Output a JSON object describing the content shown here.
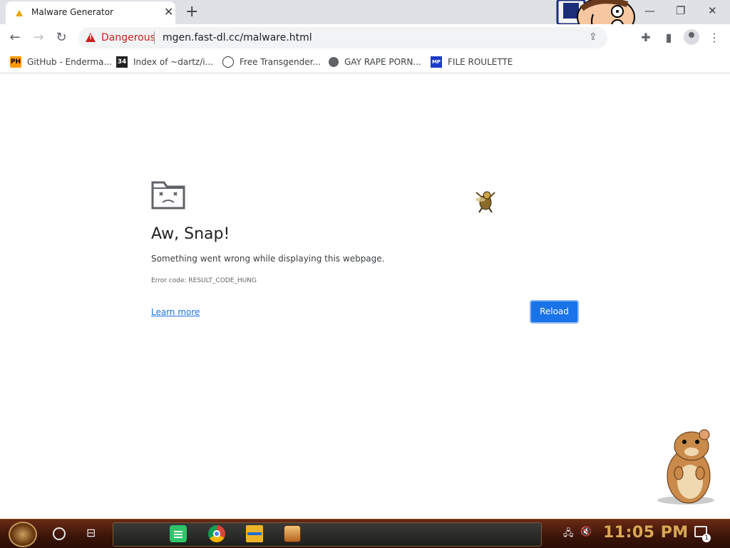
{
  "tab": {
    "title": "Malware Generator"
  },
  "toolbar": {
    "security_label": "Dangerous",
    "url": "mgen.fast-dl.cc/malware.html"
  },
  "bookmarks": [
    {
      "label": "GitHub - Enderma...",
      "icon": "ph-favicon"
    },
    {
      "label": "Index of ~dartz/i...",
      "icon": "rule34-favicon"
    },
    {
      "label": "Free Transgender...",
      "icon": "trans-favicon"
    },
    {
      "label": "GAY RAPE PORN...",
      "icon": "globe-favicon"
    },
    {
      "label": "FILE ROULETTE",
      "icon": "mp-favicon"
    }
  ],
  "bookmark_icon_text": {
    "ph": "PH",
    "r34": "34",
    "mp": "MP"
  },
  "error": {
    "title": "Aw, Snap!",
    "message": "Something went wrong while displaying this webpage.",
    "code": "Error code: RESULT_CODE_HUNG",
    "learn_more": "Learn more",
    "reload": "Reload"
  },
  "taskbar": {
    "clock": "11:05 PM",
    "notification_count": "1",
    "apps": [
      "notes-icon",
      "chrome-icon",
      "file-explorer-icon",
      "game-icon"
    ]
  },
  "colors": {
    "danger": "#c5221f",
    "accent": "#1a73e8",
    "clock": "#d8a857",
    "tabstrip": "#dee1e6"
  }
}
